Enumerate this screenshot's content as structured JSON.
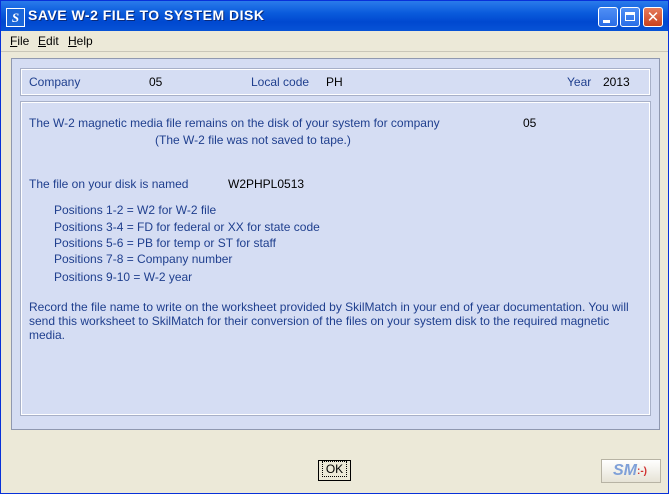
{
  "window": {
    "title": "SAVE W-2 FILE TO SYSTEM DISK",
    "icon_letter": "S"
  },
  "menu": {
    "items": [
      {
        "label_first": "F",
        "label_rest": "ile"
      },
      {
        "label_first": "E",
        "label_rest": "dit"
      },
      {
        "label_first": "H",
        "label_rest": "elp"
      }
    ]
  },
  "header": {
    "company_label": "Company",
    "company_value": "05",
    "local_code_label": "Local code",
    "local_code_value": "PH",
    "year_label": "Year",
    "year_value": "2013"
  },
  "body": {
    "line1": "The W-2 magnetic media file remains on the disk of your system for company",
    "line1_value": "05",
    "line2": "(The W-2 file was not saved to tape.)",
    "file_label": "The file on your disk is named",
    "file_value": "W2PHPL0513",
    "positions": [
      "Positions 1-2  = W2 for W-2 file",
      "Positions 3-4  = FD for federal or XX for state code",
      "Positions 5-6  = PB for temp or ST for staff",
      "Positions 7-8  = Company number",
      "Positions 9-10 = W-2 year"
    ],
    "record_para": "Record the file name to write on the worksheet provided by SkilMatch in your end of year documentation.  You will send this worksheet to SkilMatch for their conversion of the files on your system disk to the required magnetic media."
  },
  "footer": {
    "ok_label": "OK",
    "logo_text": "SM",
    "logo_face": ":-)"
  },
  "colors": {
    "label_blue": "#1f3f8e",
    "client_bg": "#D5DDF3",
    "titlebar": "#0A5BDC"
  }
}
